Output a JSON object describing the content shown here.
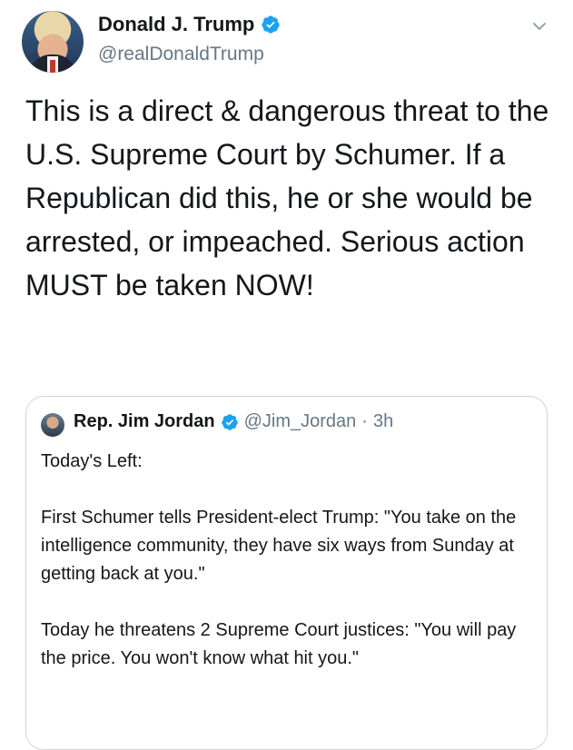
{
  "tweet": {
    "display_name": "Donald J. Trump",
    "handle": "@realDonaldTrump",
    "text": "This is a direct & dangerous threat to the U.S. Supreme Court by Schumer. If a Republican did this, he or she would be arrested, or impeached. Serious action MUST be taken NOW!",
    "verified_icon": "verified-badge-icon",
    "menu_icon": "chevron-down-icon",
    "accent_color": "#1da1f2"
  },
  "quoted_tweet": {
    "display_name": "Rep. Jim Jordan",
    "handle": "@Jim_Jordan",
    "separator": "·",
    "time": "3h",
    "paragraphs": [
      "Today's Left:",
      "First Schumer tells President-elect Trump: \"You take on the intelligence community, they have six ways from Sunday at getting back at you.\"",
      "Today he threatens 2 Supreme Court justices: \"You will pay the price. You won't know what hit you.\""
    ]
  }
}
